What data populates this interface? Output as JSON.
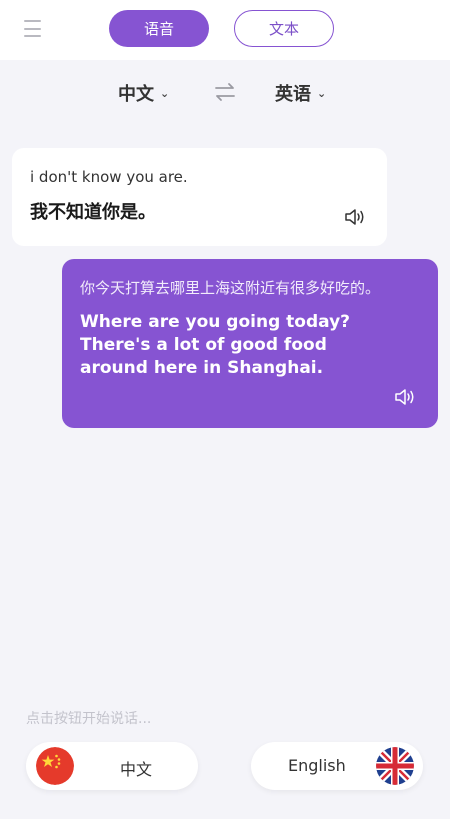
{
  "header": {
    "tabs": [
      {
        "label": "语音",
        "active": true
      },
      {
        "label": "文本",
        "active": false
      }
    ]
  },
  "languages": {
    "source": "中文",
    "target": "英语"
  },
  "conversation": [
    {
      "side": "left",
      "source_text": "i don't know you are.",
      "translated_text": "我不知道你是。"
    },
    {
      "side": "right",
      "source_text": "你今天打算去哪里上海这附近有很多好吃的。",
      "translated_text": "Where are you going today? There's a lot of good food around here in Shanghai."
    }
  ],
  "footer": {
    "hint": "点击按钮开始说话...",
    "left_button_label": "中文",
    "right_button_label": "English",
    "left_flag": "china-flag",
    "right_flag": "uk-flag"
  },
  "colors": {
    "accent": "#8654d2",
    "background": "#f4f4f9",
    "bubble_left": "#ffffff"
  }
}
